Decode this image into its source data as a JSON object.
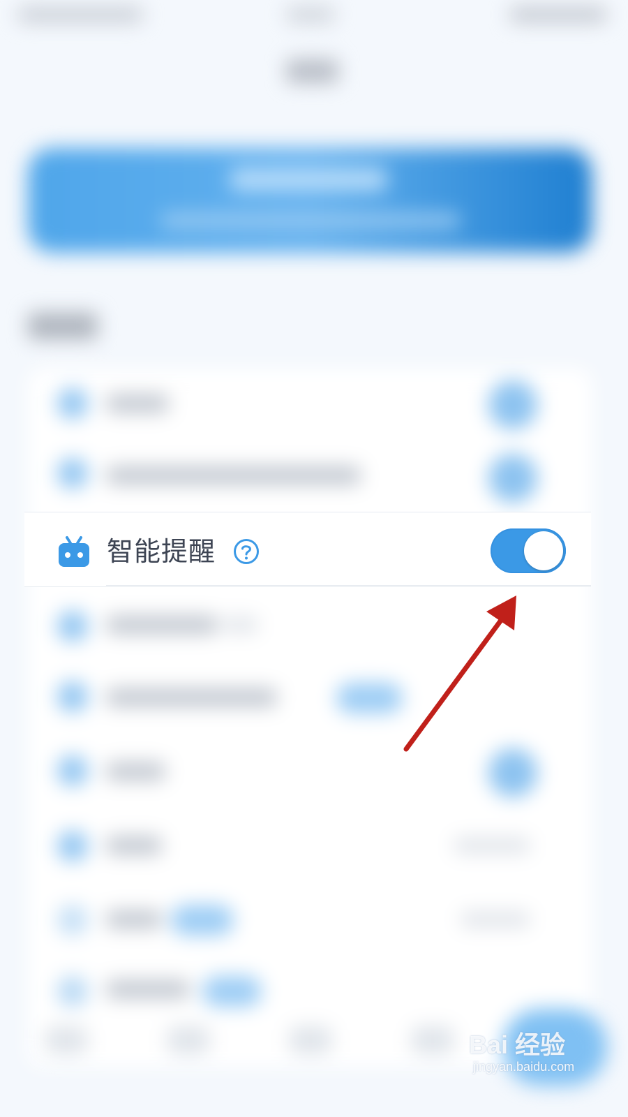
{
  "settings_row": {
    "label": "智能提醒",
    "help_icon": "question-circle-icon",
    "leading_icon": "robot-tv-icon",
    "toggle_state": "on",
    "accent_color": "#3b99e6"
  },
  "annotation": {
    "type": "arrow",
    "color": "#c0201a",
    "points_to": "smart-reminder-toggle"
  },
  "watermark": {
    "brand": "Bai 经验",
    "url": "jingyan.baidu.com"
  }
}
